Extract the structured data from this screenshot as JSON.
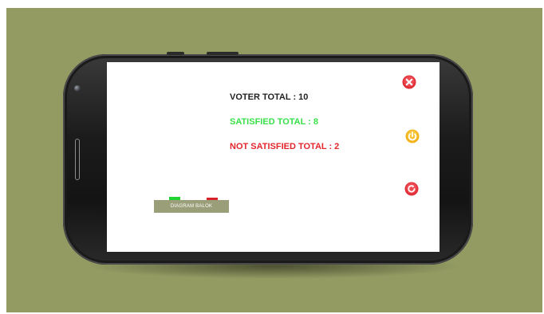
{
  "screen": {
    "voter_total": "VOTER TOTAL :  10",
    "satisfied_total": "SATISFIED TOTAL :  8",
    "not_satisfied_total": "NOT SATISFIED TOTAL :  2",
    "diagram_button_label": "DIAGRAM BALOK"
  },
  "icons": {
    "close": "close-icon",
    "power": "power-icon",
    "refresh": "refresh-icon"
  },
  "colors": {
    "backdrop": "#939b63",
    "satisfied": "#39e04b",
    "not_satisfied": "#e2262c",
    "close_icon": "#e0313a",
    "power_icon": "#f2b21a",
    "refresh_icon": "#e0313a",
    "diagram_button": "#9b9f79"
  }
}
